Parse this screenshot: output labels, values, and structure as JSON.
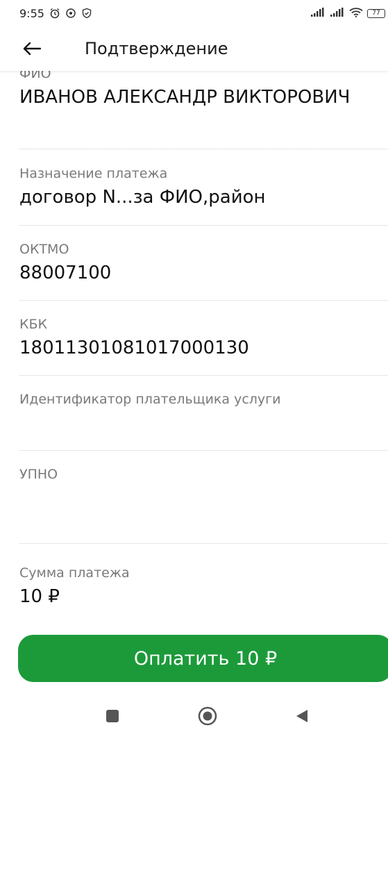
{
  "status_bar": {
    "time": "9:55",
    "icons": [
      "alarm-icon",
      "shield-icon",
      "shield-check-icon"
    ],
    "battery": "77",
    "right_icons": [
      "signal-icon",
      "signal-icon",
      "wifi-icon",
      "battery-icon"
    ]
  },
  "header": {
    "title": "Подтверждение",
    "back_icon": "arrow-left-icon"
  },
  "fields": [
    {
      "label": "ФИО",
      "value": "ИВАНОВ АЛЕКСАНДР ВИКТОРОВИЧ"
    },
    {
      "label": "Назначение платежа",
      "value": "договор N...за ФИО,район"
    },
    {
      "label": "ОКТМО",
      "value": "88007100"
    },
    {
      "label": "КБК",
      "value": "18011301081017000130"
    },
    {
      "label": "Идентификатор плательщика услуги",
      "value": ""
    },
    {
      "label": "УПНО",
      "value": ""
    },
    {
      "label": "Сумма платежа",
      "value": "10 ₽"
    }
  ],
  "pay_button": {
    "label": "Оплатить 10 ₽",
    "color": "#1c9a3a"
  },
  "nav": {
    "icons": [
      "recent-apps-icon",
      "home-icon",
      "back-triangle-icon"
    ]
  }
}
